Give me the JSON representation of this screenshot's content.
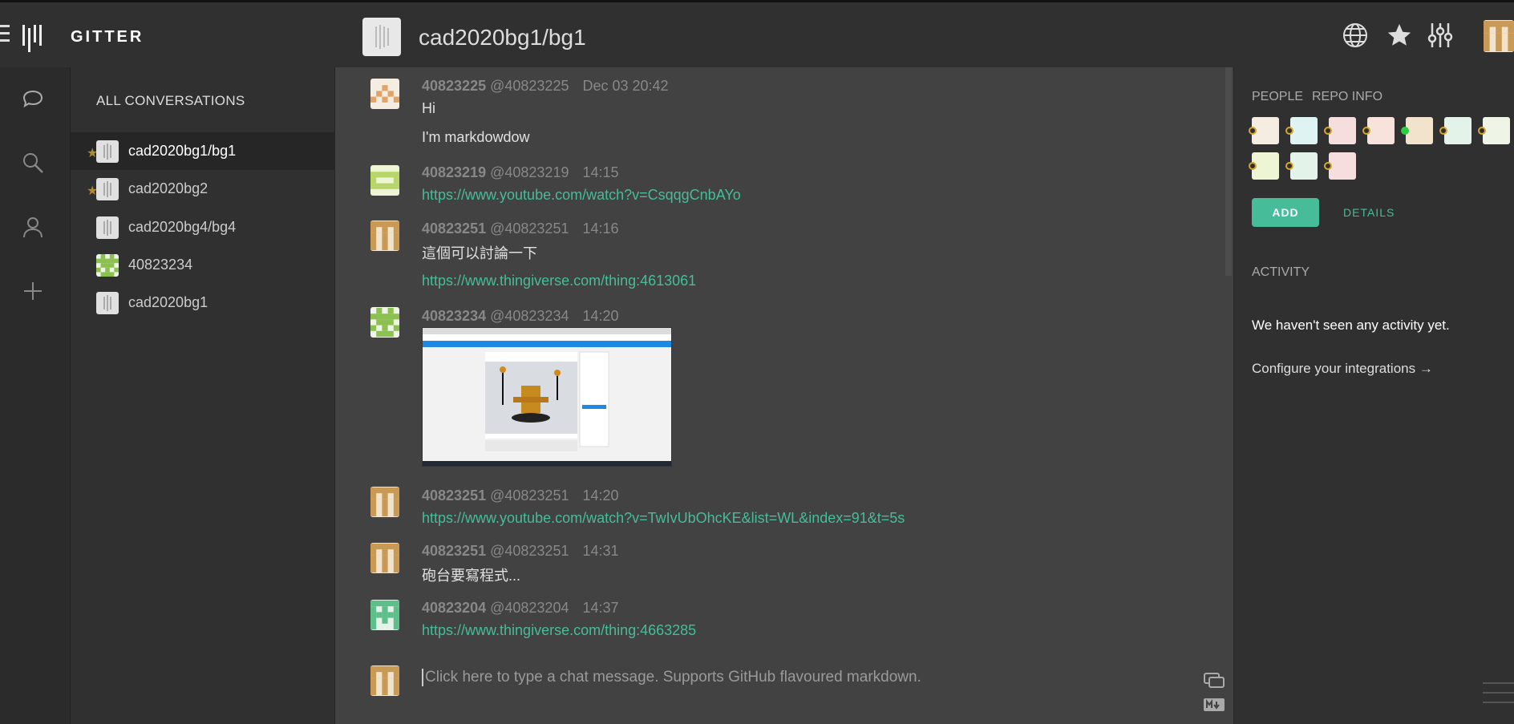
{
  "header": {
    "brand": "GITTER",
    "room_title": "cad2020bg1/bg1"
  },
  "conversations": {
    "title": "ALL CONVERSATIONS",
    "items": [
      {
        "label": "cad2020bg1/bg1",
        "active": true,
        "starred": true
      },
      {
        "label": "cad2020bg2",
        "active": false,
        "starred": true
      },
      {
        "label": "cad2020bg4/bg4",
        "active": false,
        "starred": false
      },
      {
        "label": "40823234",
        "active": false,
        "starred": false
      },
      {
        "label": "cad2020bg1",
        "active": false,
        "starred": false
      }
    ]
  },
  "messages": [
    {
      "user": "40823225",
      "handle": "@40823225",
      "time": "Dec 03 20:42",
      "lines": [
        "Hi",
        "I'm markdowdow"
      ]
    },
    {
      "user": "40823219",
      "handle": "@40823219",
      "time": "14:15",
      "link": "https://www.youtube.com/watch?v=CsqqgCnbAYo"
    },
    {
      "user": "40823251",
      "handle": "@40823251",
      "time": "14:16",
      "text": "這個可以討論一下",
      "link": "https://www.thingiverse.com/thing:4613061"
    },
    {
      "user": "40823234",
      "handle": "@40823234",
      "time": "14:20"
    },
    {
      "user": "40823251",
      "handle": "@40823251",
      "time": "14:20",
      "link": "https://www.youtube.com/watch?v=TwIvUbOhcKE&list=WL&index=91&t=5s"
    },
    {
      "user": "40823251",
      "handle": "@40823251",
      "time": "14:31",
      "text": "砲台要寫程式..."
    },
    {
      "user": "40823204",
      "handle": "@40823204",
      "time": "14:37",
      "link": "https://www.thingiverse.com/thing:4663285"
    }
  ],
  "composer": {
    "placeholder": "Click here to type a chat message. Supports GitHub flavoured markdown."
  },
  "right_panel": {
    "tab_people": "PEOPLE",
    "tab_repo": "REPO INFO",
    "add_label": "ADD",
    "details_label": "DETAILS",
    "activity_title": "ACTIVITY",
    "no_activity": "We haven't seen any activity yet.",
    "integrations": "Configure your integrations →"
  },
  "colors": {
    "accent": "#46bc99",
    "background": "#424242"
  }
}
